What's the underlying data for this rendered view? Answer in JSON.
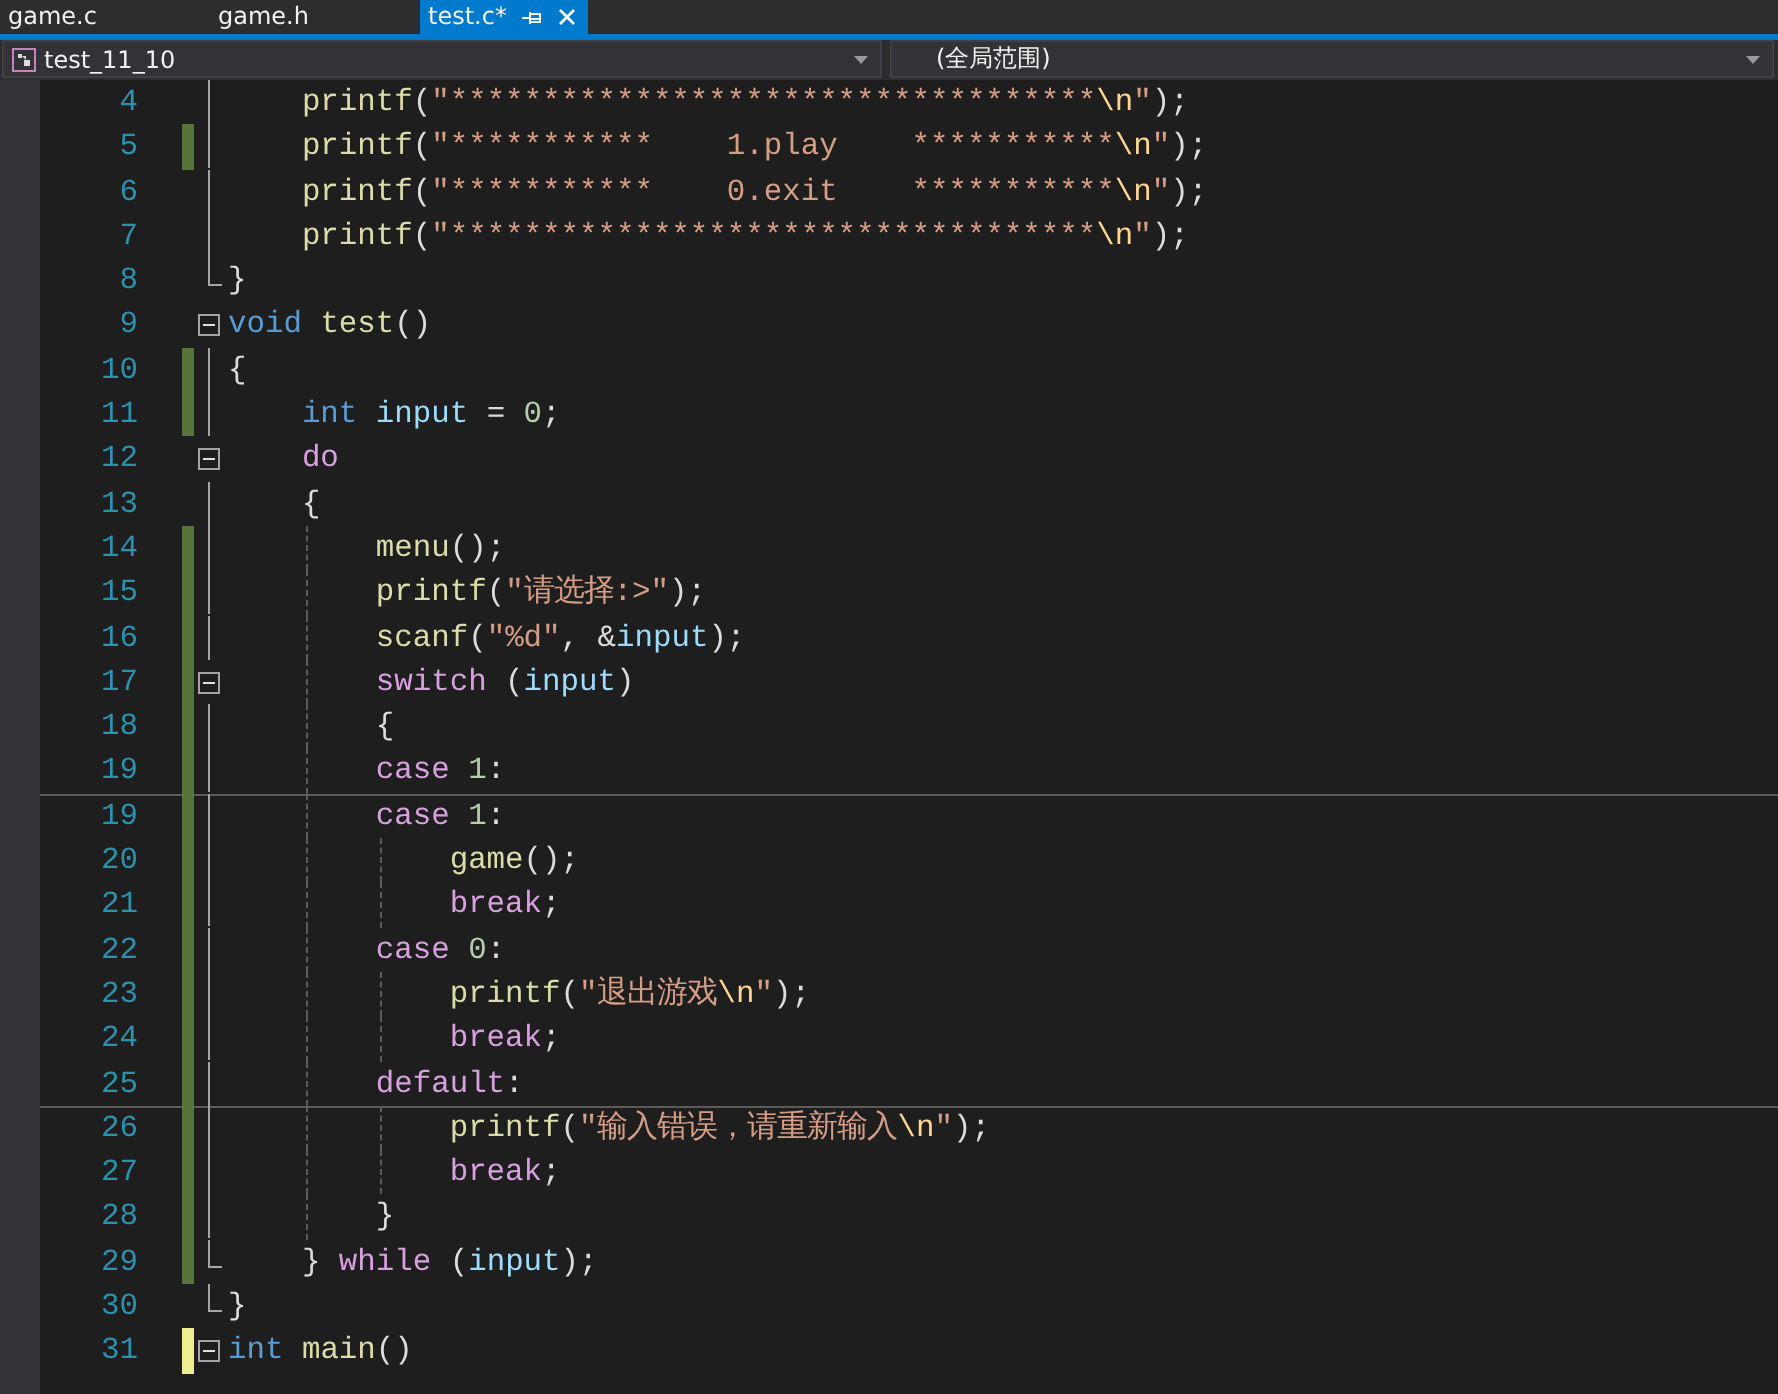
{
  "tabs": [
    {
      "label": "game.c",
      "selected": false
    },
    {
      "label": "game.h",
      "selected": false
    },
    {
      "label": "test.c*",
      "selected": true
    }
  ],
  "nav": {
    "scope": "test_11_10",
    "member": "(全局范围)"
  },
  "lines": [
    {
      "number": "4",
      "fold": {
        "kind": "line"
      },
      "seam": false,
      "tokens": [
        {
          "kind": "fn",
          "t": "    printf"
        },
        {
          "kind": "p",
          "t": "("
        },
        {
          "kind": "str",
          "t": "\"***********************************"
        },
        {
          "kind": "esc",
          "t": "\\n"
        },
        {
          "kind": "str",
          "t": "\""
        },
        {
          "kind": "p",
          "t": ");"
        }
      ]
    },
    {
      "number": "5",
      "change": {
        "kind": "saved"
      },
      "fold": {
        "kind": "line"
      },
      "seam": false,
      "tokens": [
        {
          "kind": "fn",
          "t": "    printf"
        },
        {
          "kind": "p",
          "t": "("
        },
        {
          "kind": "str",
          "t": "\"***********    1.play    ***********"
        },
        {
          "kind": "esc",
          "t": "\\n"
        },
        {
          "kind": "str",
          "t": "\""
        },
        {
          "kind": "p",
          "t": ");"
        }
      ]
    },
    {
      "number": "6",
      "fold": {
        "kind": "line"
      },
      "seam": false,
      "tokens": [
        {
          "kind": "fn",
          "t": "    printf"
        },
        {
          "kind": "p",
          "t": "("
        },
        {
          "kind": "str",
          "t": "\"***********    0.exit    ***********"
        },
        {
          "kind": "esc",
          "t": "\\n"
        },
        {
          "kind": "str",
          "t": "\""
        },
        {
          "kind": "p",
          "t": ");"
        }
      ]
    },
    {
      "number": "7",
      "fold": {
        "kind": "line"
      },
      "seam": false,
      "tokens": [
        {
          "kind": "fn",
          "t": "    printf"
        },
        {
          "kind": "p",
          "t": "("
        },
        {
          "kind": "str",
          "t": "\"***********************************"
        },
        {
          "kind": "esc",
          "t": "\\n"
        },
        {
          "kind": "str",
          "t": "\""
        },
        {
          "kind": "p",
          "t": ");"
        }
      ]
    },
    {
      "number": "8",
      "fold": {
        "kind": "end"
      },
      "seam": false,
      "tokens": [
        {
          "kind": "p",
          "t": "}"
        }
      ]
    },
    {
      "number": "9",
      "fold": {
        "kind": "start"
      },
      "seam": false,
      "tokens": [
        {
          "kind": "kw",
          "t": "void "
        },
        {
          "kind": "fn",
          "t": "test"
        },
        {
          "kind": "p",
          "t": "()"
        }
      ]
    },
    {
      "number": "10",
      "change": {
        "kind": "saved"
      },
      "fold": {
        "kind": "line"
      },
      "seam": false,
      "tokens": [
        {
          "kind": "p",
          "t": "{"
        }
      ]
    },
    {
      "number": "11",
      "change": {
        "kind": "saved"
      },
      "fold": {
        "kind": "line"
      },
      "seam": false,
      "tokens": [
        {
          "kind": "kw",
          "t": "    int "
        },
        {
          "kind": "var",
          "t": "input"
        },
        {
          "kind": "p",
          "t": " = "
        },
        {
          "kind": "num",
          "t": "0"
        },
        {
          "kind": "p",
          "t": ";"
        }
      ]
    },
    {
      "number": "12",
      "fold": {
        "kind": "start"
      },
      "seam": false,
      "tokens": [
        {
          "kind": "ctl",
          "t": "    do"
        }
      ]
    },
    {
      "number": "13",
      "fold": {
        "kind": "line"
      },
      "seam": false,
      "tokens": [
        {
          "kind": "p",
          "t": "    {"
        }
      ]
    },
    {
      "number": "14",
      "change": {
        "kind": "saved"
      },
      "fold": {
        "kind": "line"
      },
      "seam": false,
      "tokens": [
        {
          "kind": "fn",
          "t": "        menu"
        },
        {
          "kind": "p",
          "t": "();"
        }
      ]
    },
    {
      "number": "15",
      "change": {
        "kind": "saved"
      },
      "fold": {
        "kind": "line"
      },
      "seam": false,
      "tokens": [
        {
          "kind": "fn",
          "t": "        printf"
        },
        {
          "kind": "p",
          "t": "("
        },
        {
          "kind": "str",
          "t": "\"请选择:>\""
        },
        {
          "kind": "p",
          "t": ");"
        }
      ]
    },
    {
      "number": "16",
      "change": {
        "kind": "saved"
      },
      "fold": {
        "kind": "line"
      },
      "seam": false,
      "tokens": [
        {
          "kind": "fn",
          "t": "        scanf"
        },
        {
          "kind": "p",
          "t": "("
        },
        {
          "kind": "str",
          "t": "\"%d\""
        },
        {
          "kind": "p",
          "t": ", &"
        },
        {
          "kind": "var",
          "t": "input"
        },
        {
          "kind": "p",
          "t": ");"
        }
      ]
    },
    {
      "number": "17",
      "change": {
        "kind": "saved"
      },
      "fold": {
        "kind": "start"
      },
      "seam": false,
      "tokens": [
        {
          "kind": "ctl",
          "t": "        switch"
        },
        {
          "kind": "p",
          "t": " ("
        },
        {
          "kind": "var",
          "t": "input"
        },
        {
          "kind": "p",
          "t": ")"
        }
      ]
    },
    {
      "number": "18",
      "change": {
        "kind": "saved"
      },
      "fold": {
        "kind": "line"
      },
      "seam": false,
      "tokens": [
        {
          "kind": "p",
          "t": "        {"
        }
      ]
    },
    {
      "number": "19",
      "change": {
        "kind": "saved"
      },
      "fold": {
        "kind": "line"
      },
      "seam": false,
      "tokens": [
        {
          "kind": "ctl",
          "t": "        case "
        },
        {
          "kind": "num",
          "t": "1"
        },
        {
          "kind": "p",
          "t": ":"
        }
      ]
    },
    {
      "number": "19",
      "change": {
        "kind": "saved"
      },
      "fold": {
        "kind": "line"
      },
      "seam": true,
      "tokens": [
        {
          "kind": "ctl",
          "t": "        case "
        },
        {
          "kind": "num",
          "t": "1"
        },
        {
          "kind": "p",
          "t": ":"
        }
      ]
    },
    {
      "number": "20",
      "change": {
        "kind": "saved"
      },
      "fold": {
        "kind": "line"
      },
      "seam": false,
      "tokens": [
        {
          "kind": "fn",
          "t": "            game"
        },
        {
          "kind": "p",
          "t": "();"
        }
      ]
    },
    {
      "number": "21",
      "change": {
        "kind": "saved"
      },
      "fold": {
        "kind": "line"
      },
      "seam": false,
      "tokens": [
        {
          "kind": "ctl",
          "t": "            break"
        },
        {
          "kind": "p",
          "t": ";"
        }
      ]
    },
    {
      "number": "22",
      "change": {
        "kind": "saved"
      },
      "fold": {
        "kind": "line"
      },
      "seam": false,
      "tokens": [
        {
          "kind": "ctl",
          "t": "        case "
        },
        {
          "kind": "num",
          "t": "0"
        },
        {
          "kind": "p",
          "t": ":"
        }
      ]
    },
    {
      "number": "23",
      "change": {
        "kind": "saved"
      },
      "fold": {
        "kind": "line"
      },
      "seam": false,
      "tokens": [
        {
          "kind": "fn",
          "t": "            printf"
        },
        {
          "kind": "p",
          "t": "("
        },
        {
          "kind": "str",
          "t": "\"退出游戏"
        },
        {
          "kind": "esc",
          "t": "\\n"
        },
        {
          "kind": "str",
          "t": "\""
        },
        {
          "kind": "p",
          "t": ");"
        }
      ]
    },
    {
      "number": "24",
      "change": {
        "kind": "saved"
      },
      "fold": {
        "kind": "line"
      },
      "seam": false,
      "tokens": [
        {
          "kind": "ctl",
          "t": "            break"
        },
        {
          "kind": "p",
          "t": ";"
        }
      ]
    },
    {
      "number": "25",
      "change": {
        "kind": "saved"
      },
      "fold": {
        "kind": "line"
      },
      "seam": false,
      "tokens": [
        {
          "kind": "ctl",
          "t": "        default"
        },
        {
          "kind": "p",
          "t": ":"
        }
      ]
    },
    {
      "number": "26",
      "change": {
        "kind": "saved"
      },
      "fold": {
        "kind": "line"
      },
      "seam": true,
      "tokens": [
        {
          "kind": "fn",
          "t": "            printf"
        },
        {
          "kind": "p",
          "t": "("
        },
        {
          "kind": "str",
          "t": "\"输入错误，请重新输入"
        },
        {
          "kind": "esc",
          "t": "\\n"
        },
        {
          "kind": "str",
          "t": "\""
        },
        {
          "kind": "p",
          "t": ");"
        }
      ]
    },
    {
      "number": "27",
      "change": {
        "kind": "saved"
      },
      "fold": {
        "kind": "line"
      },
      "seam": false,
      "tokens": [
        {
          "kind": "ctl",
          "t": "            break"
        },
        {
          "kind": "p",
          "t": ";"
        }
      ]
    },
    {
      "number": "28",
      "change": {
        "kind": "saved"
      },
      "fold": {
        "kind": "line"
      },
      "seam": false,
      "tokens": [
        {
          "kind": "p",
          "t": "        }"
        }
      ]
    },
    {
      "number": "29",
      "change": {
        "kind": "saved"
      },
      "fold": {
        "kind": "end"
      },
      "seam": false,
      "tokens": [
        {
          "kind": "p",
          "t": "    } "
        },
        {
          "kind": "ctl",
          "t": "while"
        },
        {
          "kind": "p",
          "t": " ("
        },
        {
          "kind": "var",
          "t": "input"
        },
        {
          "kind": "p",
          "t": ");"
        }
      ]
    },
    {
      "number": "30",
      "fold": {
        "kind": "end"
      },
      "seam": false,
      "tokens": [
        {
          "kind": "p",
          "t": "}"
        }
      ]
    },
    {
      "number": "31",
      "change": {
        "kind": "unsaved"
      },
      "fold": {
        "kind": "start"
      },
      "seam": false,
      "tokens": [
        {
          "kind": "kw",
          "t": "int "
        },
        {
          "kind": "fn",
          "t": "main"
        },
        {
          "kind": "p",
          "t": "()"
        }
      ]
    }
  ]
}
